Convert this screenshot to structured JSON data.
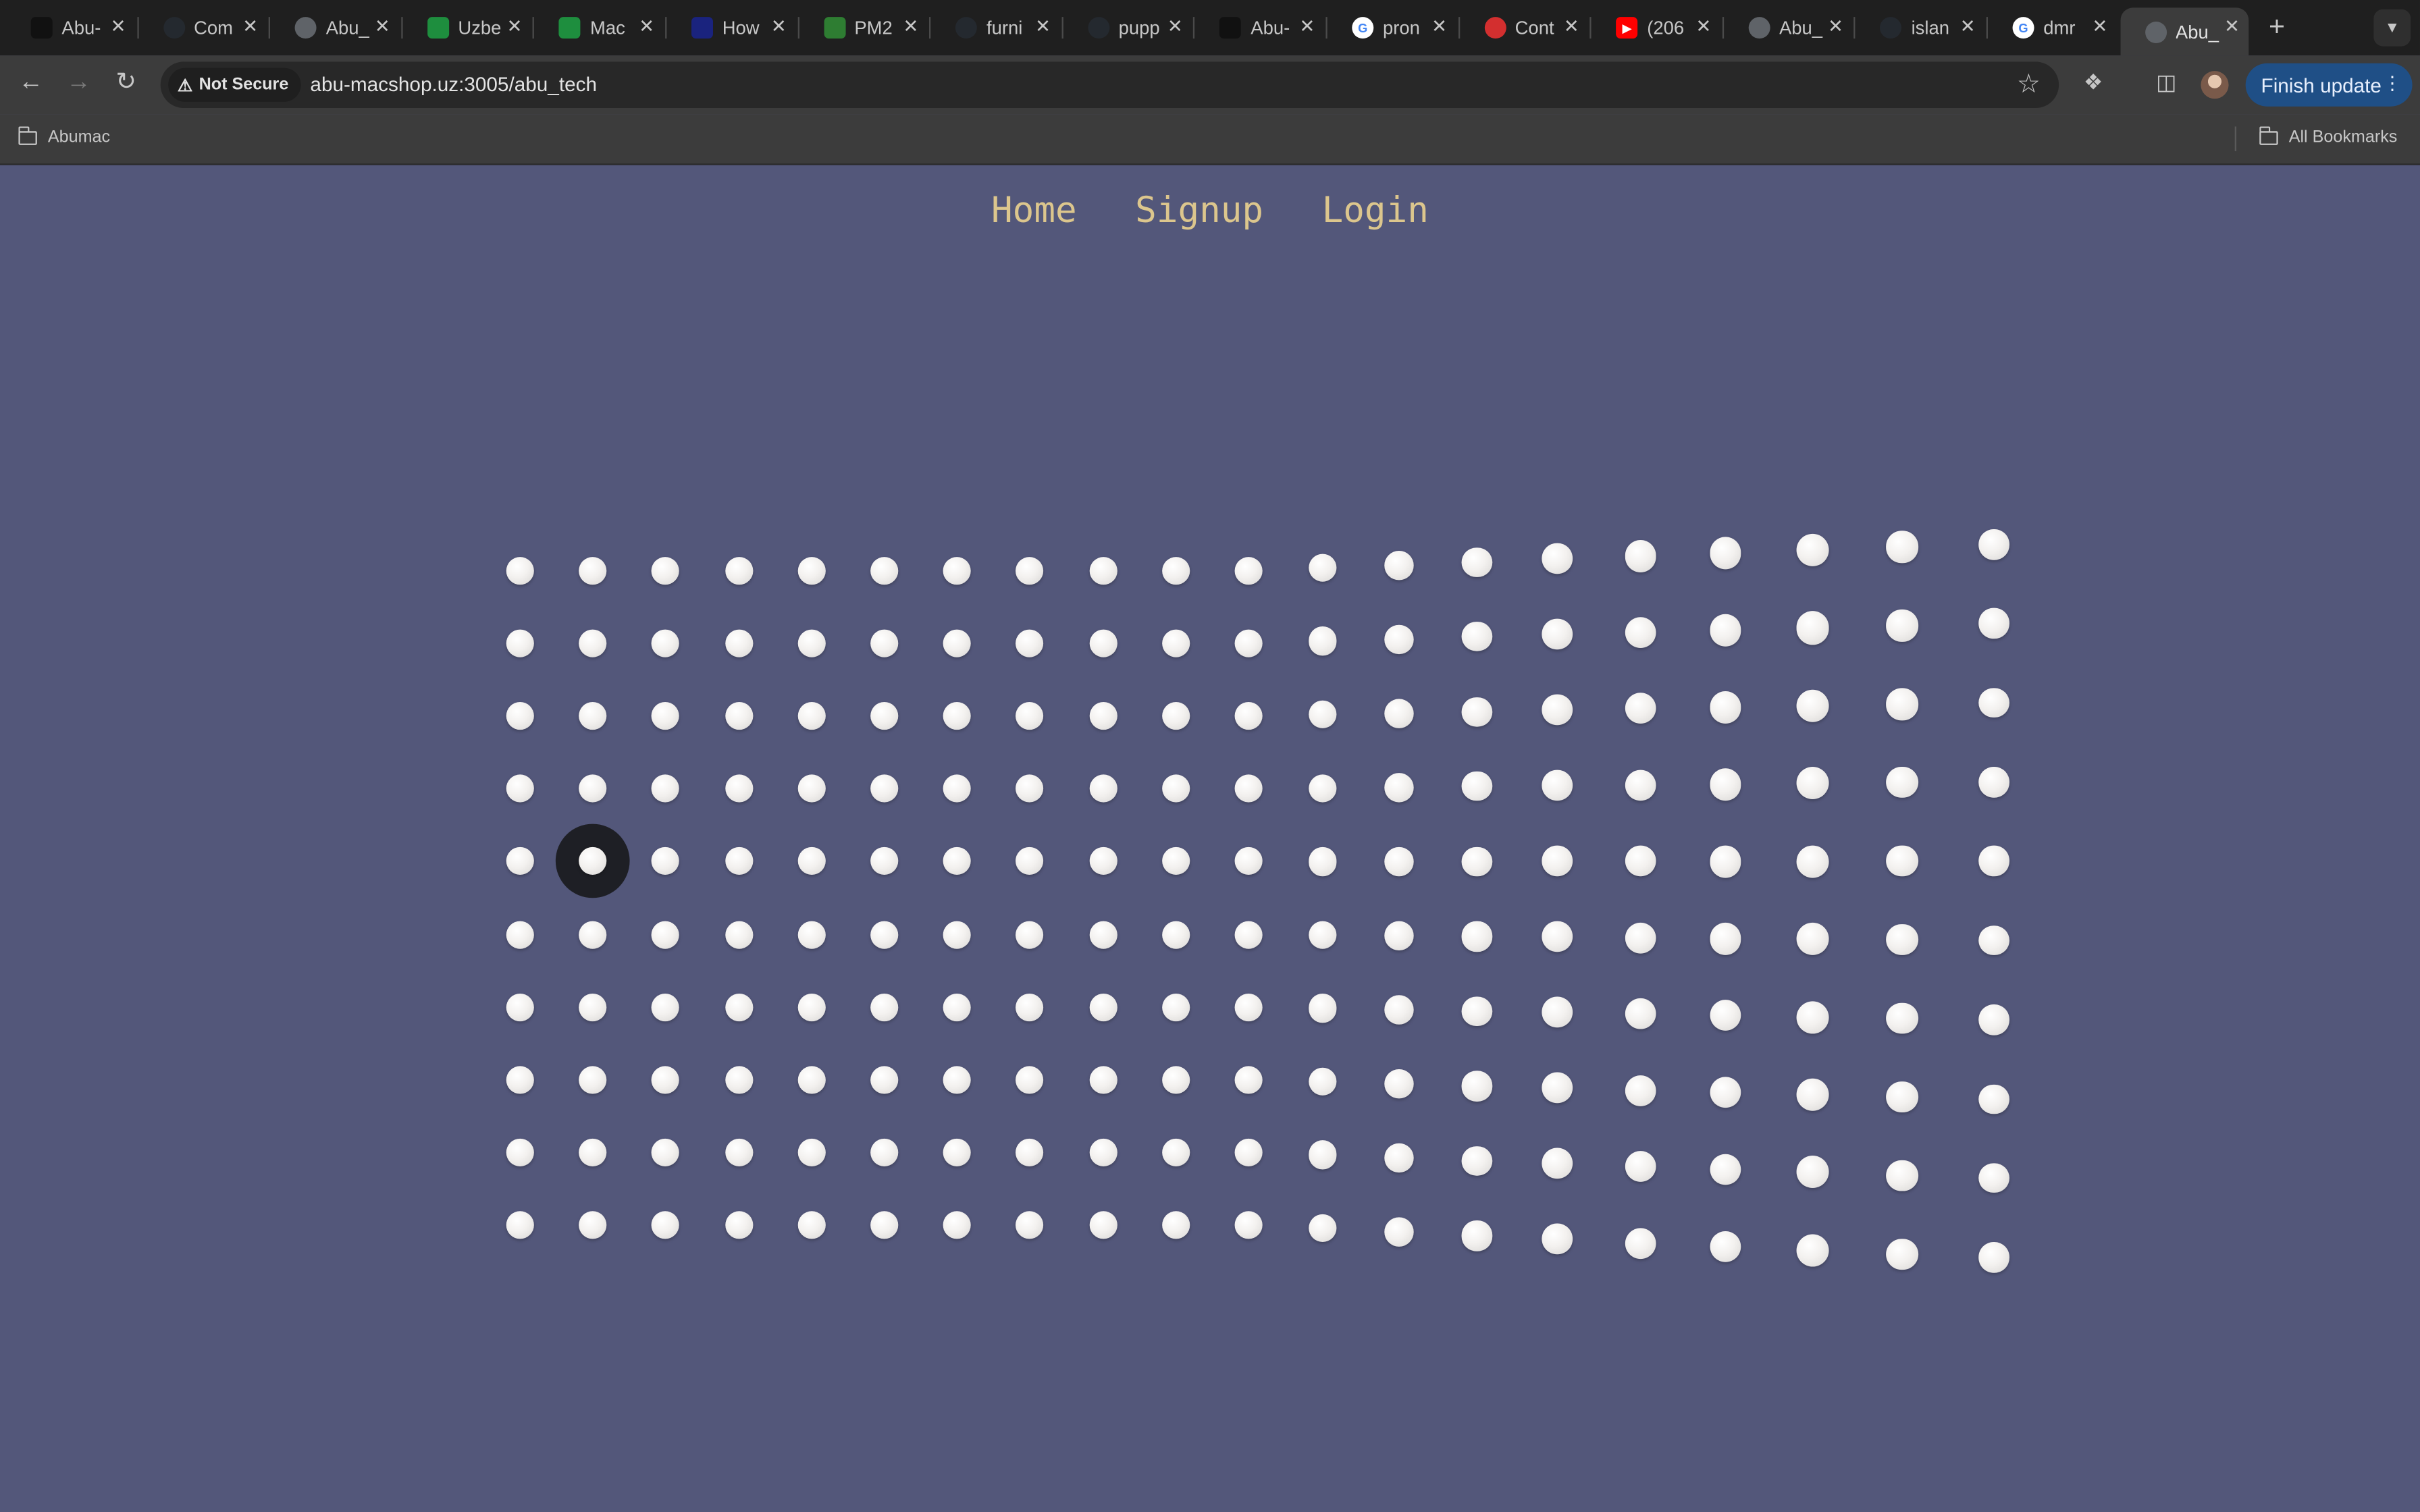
{
  "browser": {
    "tabs": [
      {
        "title": "Abu-",
        "favicon": "abu-logo-icon",
        "color": "#111111"
      },
      {
        "title": "Com",
        "favicon": "github-icon",
        "color": "#24292f"
      },
      {
        "title": "Abu_",
        "favicon": "globe-icon",
        "color": "#5f6368"
      },
      {
        "title": "Uzbe",
        "favicon": "sheets-icon",
        "color": "#1e8e3e"
      },
      {
        "title": "Mac",
        "favicon": "sheets-icon",
        "color": "#1e8e3e"
      },
      {
        "title": "How",
        "favicon": "article-icon",
        "color": "#1a237e"
      },
      {
        "title": "PM2",
        "favicon": "pm2-icon",
        "color": "#2e7d32"
      },
      {
        "title": "furni",
        "favicon": "github-icon",
        "color": "#24292f"
      },
      {
        "title": "pupp",
        "favicon": "github-icon",
        "color": "#24292f"
      },
      {
        "title": "Abu-",
        "favicon": "abu-logo-icon",
        "color": "#111111"
      },
      {
        "title": "pron",
        "favicon": "google-icon",
        "color": "#ffffff"
      },
      {
        "title": "Cont",
        "favicon": "ring-icon",
        "color": "#d32f2f"
      },
      {
        "title": "(206",
        "favicon": "youtube-icon",
        "color": "#ff0000"
      },
      {
        "title": "Abu_",
        "favicon": "globe-icon",
        "color": "#5f6368"
      },
      {
        "title": "islan",
        "favicon": "github-icon",
        "color": "#24292f"
      },
      {
        "title": "dmr",
        "favicon": "google-icon",
        "color": "#ffffff"
      },
      {
        "title": "Abu_",
        "favicon": "globe-icon",
        "color": "#5f6368",
        "active": true
      }
    ],
    "security_label": "Not Secure",
    "url": "abu-macshop.uz:3005/abu_tech",
    "update_button": "Finish update",
    "bookmark_folder": "Abumac",
    "all_bookmarks": "All Bookmarks"
  },
  "nav": {
    "home": "Home",
    "signup": "Signup",
    "login": "Login"
  },
  "dot_grid": {
    "rows": 10,
    "columns": 20,
    "dot_color": "#f3f1ef",
    "background": "#53577a",
    "nav_color": "#dcc68d",
    "highlighted": {
      "row": 5,
      "column": 2
    }
  }
}
